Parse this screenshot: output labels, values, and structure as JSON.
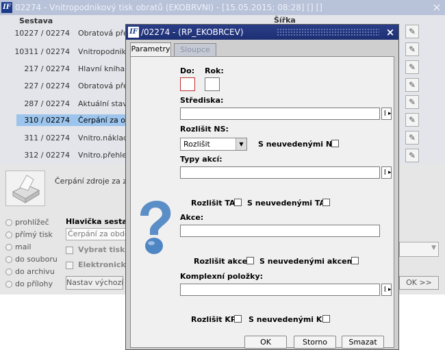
{
  "background_window": {
    "title": "02274 - Vnitropodnikový tisk obratů (EKOBRVNI) - [15.05.2015; 08:28] [] []",
    "close": "×",
    "headers": {
      "sestava": "Sestava",
      "sirka": "Šířka"
    },
    "rows": [
      {
        "num": "10227 / 02274",
        "name": "Obratová před"
      },
      {
        "num": "10311 / 02274",
        "name": "Vnitropodnikov"
      },
      {
        "num": "217 / 02274",
        "name": "Hlavní kniha p"
      },
      {
        "num": "227 / 02274",
        "name": "Obratová před"
      },
      {
        "num": "287 / 02274",
        "name": "Aktuální stavy"
      },
      {
        "num": "310 / 02274",
        "name": "Čerpání za o"
      },
      {
        "num": "311 / 02274",
        "name": "Vnitro.náklady"
      },
      {
        "num": "312 / 02274",
        "name": "Vnitro.přehled"
      }
    ],
    "selected_index": 5,
    "description": "Čerpání zdroje za za",
    "radios": [
      "prohlížeč",
      "přímý tisk",
      "mail",
      "do souboru",
      "do archivu",
      "do přílohy"
    ],
    "header_label": "Hlavička sestav",
    "header_input": "Čerpání za obdob",
    "checkbox1": "Vybrat tiská",
    "checkbox2": "Elektronický",
    "default_button": "Nastav výchozí",
    "ok_next": "OK >>"
  },
  "dialog": {
    "title": "/02274 - (RP_EKOBRCEV)",
    "close": "×",
    "tabs": [
      "Parametry",
      "Sloupce"
    ],
    "labels": {
      "do": "Do:",
      "rok": "Rok:",
      "strediska": "Střediska:",
      "rozlisit_ns": "Rozlišit NS:",
      "s_neuvedenymi_ns": "S neuvedenými NS",
      "typy_akci": "Typy akcí:",
      "rozlisit_ta": "Rozlišit TA",
      "s_neuvedenymi_ta": "S neuvedenými TA",
      "akce": "Akce:",
      "rozlisit_akce": "Rozlišit akce",
      "s_neuvedenymi_akcemi": "S neuvedenými akcemi",
      "komplexni_polozky": "Komplexní položky:",
      "rozlisit_kp": "Rozlišit KP",
      "s_neuvedenymi_kp": "S neuvedenými KP"
    },
    "select_value": "Rozlišit",
    "buttons": {
      "ok": "OK",
      "storno": "Storno",
      "smazat": "Smazat"
    }
  }
}
